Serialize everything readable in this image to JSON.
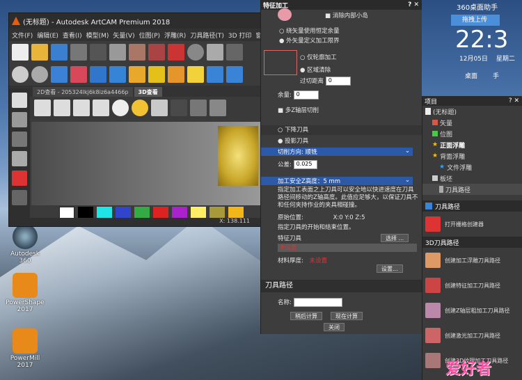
{
  "desktop": {
    "icons": [
      {
        "label": "Autodesk\n360"
      },
      {
        "label": "PowerShape\n2017"
      },
      {
        "label": "PowerMill\n2017"
      }
    ]
  },
  "widget": {
    "title": "360桌面助手",
    "upload": "拖拽上传",
    "time": "22:3",
    "date": "12月05日",
    "weekday": "星期二",
    "desktop_label": "桌面",
    "phone_label": "手"
  },
  "main": {
    "title": "(无标题) - Autodesk ArtCAM Premium 2018",
    "menu": [
      "文件(F)",
      "编辑(E)",
      "查看(I)",
      "模型(M)",
      "矢量(V)",
      "位图(P)",
      "浮雕(R)",
      "刀具路径(T)",
      "3D 打印",
      "窗口(W)"
    ],
    "tabs": [
      "2D查看 - 205324lkj6k8iz6a4466p",
      "3D查看"
    ],
    "status": "X: 138.111",
    "colors": [
      "#000000",
      "#ffffff",
      "#000000",
      "#1fe5e5",
      "#3344cc",
      "#33aa44",
      "#dd2222",
      "#aa22cc",
      "#ffee66",
      "#a89a3a",
      "#f2b61a",
      "#555555"
    ]
  },
  "feature": {
    "title": "特征加工",
    "remove_inside": "消除内部小岛",
    "opt1": "绕矢量使用恒定余量",
    "opt2": "外矢量定义加工限界",
    "opt3": "仅轮廓加工",
    "opt4": "区域清除",
    "overshoot_label": "过切距离",
    "overshoot_value": "0",
    "allowance_label": "余量:",
    "allowance_value": "0",
    "two_axis": "多Z轴层切削",
    "down_tool": "下降刀具",
    "project_tool": "投影刀具",
    "cut_dir": "切削方向: 顺铣",
    "tol_label": "公差:",
    "tol_value": "0.025",
    "safez": "加工安全Z高度：5 mm",
    "safez_desc": "指定加工表面之上刀具可以安全地以快进速度在刀具路径间移动的Z轴高度。此值应足够大，以保证刀具不和任何夹持作业的夹具相碰撞。",
    "home_label": "原始位置:",
    "home_value": "X:0 Y:0 Z:5",
    "home_desc": "指定刀具的开始和结束位置。",
    "tool_label": "特征刀具",
    "select_btn": "选择 ...",
    "tool_unset": "未设置",
    "material_label": "材料厚度:",
    "material_unset": "未设置",
    "setup_btn": "设置...",
    "toolpath_title": "刀具路径",
    "name_label": "名称:",
    "calc_later": "稍后计算",
    "calc_now": "现在计算",
    "close_btn": "关闭"
  },
  "project": {
    "title": "项目",
    "items": [
      "(无标题)",
      "矢量",
      "位图",
      "正面浮雕",
      "背面浮雕",
      "文件浮雕",
      "板坯",
      "刀具路径"
    ],
    "toolpath_title": "刀具路径",
    "raster": "打开栅格创建器",
    "sec3d": "3D刀具路径",
    "tp_items": [
      "创建加工浮雕刀具路径",
      "创建特征加工刀具路径",
      "创建Z轴层粗加工刀具路径",
      "创建激光加工刀具路径",
      "创建3D纹理加工刀具路径"
    ]
  },
  "watermark": "爱好者"
}
